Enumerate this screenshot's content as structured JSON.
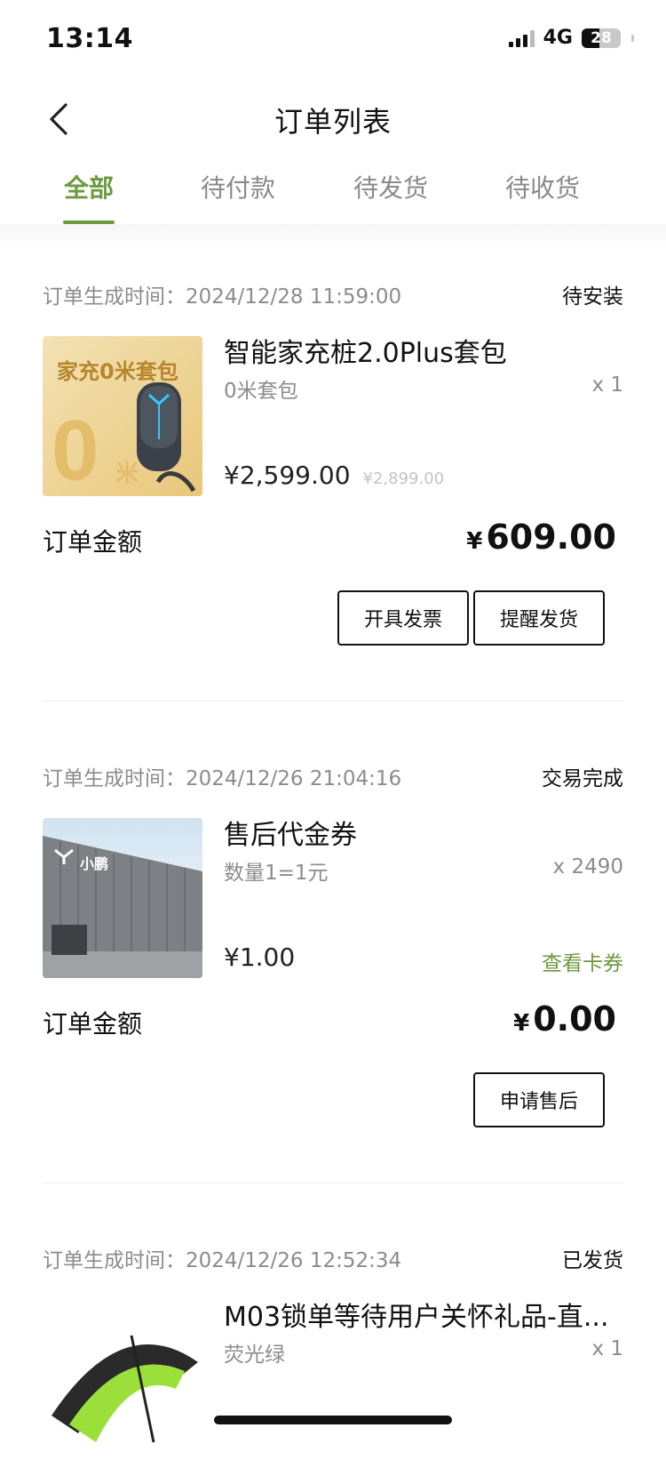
{
  "status_bar": {
    "time": "13:14",
    "network": "4G",
    "battery": "28"
  },
  "header": {
    "title": "订单列表"
  },
  "tabs": [
    {
      "label": "全部",
      "active": true
    },
    {
      "label": "待付款",
      "active": false
    },
    {
      "label": "待发货",
      "active": false
    },
    {
      "label": "待收货",
      "active": false
    }
  ],
  "orders": [
    {
      "time_label": "订单生成时间：2024/12/28 11:59:00",
      "status": "待安装",
      "thumb_text_top": "家充0米套包",
      "thumb_big": "0",
      "thumb_small": "米",
      "name": "智能家充桩2.0Plus套包",
      "spec": "0米套包",
      "qty": "x 1",
      "price": "¥2,599.00",
      "original_price": "¥2,899.00",
      "amount_label": "订单金额",
      "amount_symbol": "¥",
      "amount": "609.00",
      "buttons": [
        "开具发票",
        "提醒发货"
      ]
    },
    {
      "time_label": "订单生成时间：2024/12/26 21:04:16",
      "status": "交易完成",
      "thumb_logo_text": "小鹏",
      "name": "售后代金券",
      "spec": "数量1=1元",
      "qty": "x 2490",
      "price": "¥1.00",
      "link": "查看卡券",
      "amount_label": "订单金额",
      "amount_symbol": "¥",
      "amount": "0.00",
      "buttons": [
        "申请售后"
      ]
    },
    {
      "time_label": "订单生成时间：2024/12/26 12:52:34",
      "status": "已发货",
      "name": "M03锁单等待用户关怀礼品-直...",
      "spec": "荧光绿",
      "qty": "x 1"
    }
  ],
  "colors": {
    "accent": "#6c9a3f",
    "muted": "#8c8c8c"
  }
}
